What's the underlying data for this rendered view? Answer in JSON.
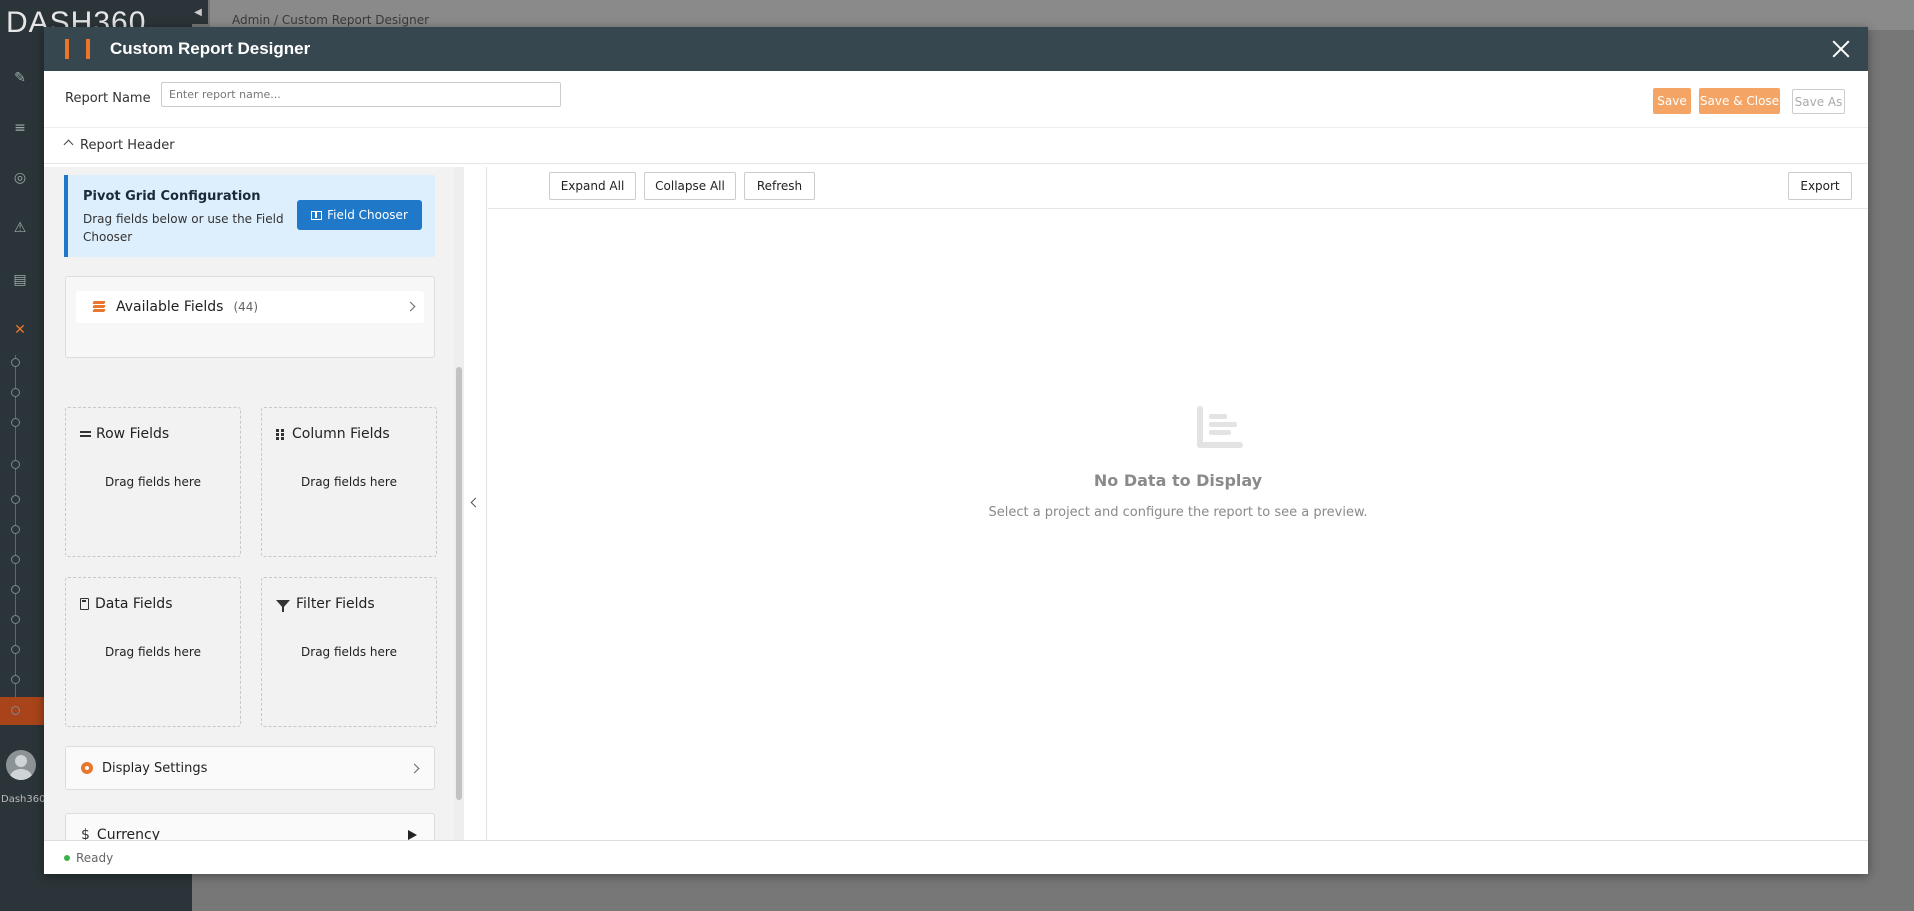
{
  "background": {
    "logo": "DASH360",
    "breadcrumb": "Admin  /  Custom Report Designer",
    "user_name": "Dash360"
  },
  "modal": {
    "title": "Custom Report Designer",
    "report_name_label": "Report Name",
    "report_name_placeholder": "Enter report name...",
    "report_name_value": "",
    "buttons": {
      "save": "Save",
      "save_close": "Save & Close",
      "save_as": "Save As"
    },
    "section_header": "Report Header",
    "config": {
      "title": "Pivot Grid Configuration",
      "description": "Drag fields below or use the Field Chooser",
      "field_chooser_label": "Field Chooser"
    },
    "available_fields": {
      "label": "Available Fields",
      "count": "(44)"
    },
    "drop_zones": {
      "rows": {
        "title": "Row Fields",
        "hint": "Drag fields here"
      },
      "columns": {
        "title": "Column Fields",
        "hint": "Drag fields here"
      },
      "data": {
        "title": "Data Fields",
        "hint": "Drag fields here"
      },
      "filters": {
        "title": "Filter Fields",
        "hint": "Drag fields here"
      }
    },
    "display_settings_label": "Display Settings",
    "currency": {
      "symbol": "$",
      "label": "Currency"
    },
    "toolbar": {
      "expand_all": "Expand All",
      "collapse_all": "Collapse All",
      "refresh": "Refresh",
      "export": "Export"
    },
    "empty_state": {
      "title": "No Data to Display",
      "subtitle": "Select a project and configure the report to see a preview."
    },
    "status": "Ready"
  },
  "colors": {
    "header_bg": "#37474f",
    "accent_orange": "#e8762d",
    "primary_blue": "#1f78c8",
    "status_green": "#3cb04a"
  },
  "icons": [
    "close-icon",
    "chevron-up-icon",
    "field-chooser-icon",
    "layers-icon",
    "chevron-right-icon",
    "rows-icon",
    "columns-icon",
    "calculator-icon",
    "filter-icon",
    "gear-icon",
    "dollar-icon",
    "play-icon",
    "chevron-left-icon",
    "chart-empty-icon"
  ]
}
